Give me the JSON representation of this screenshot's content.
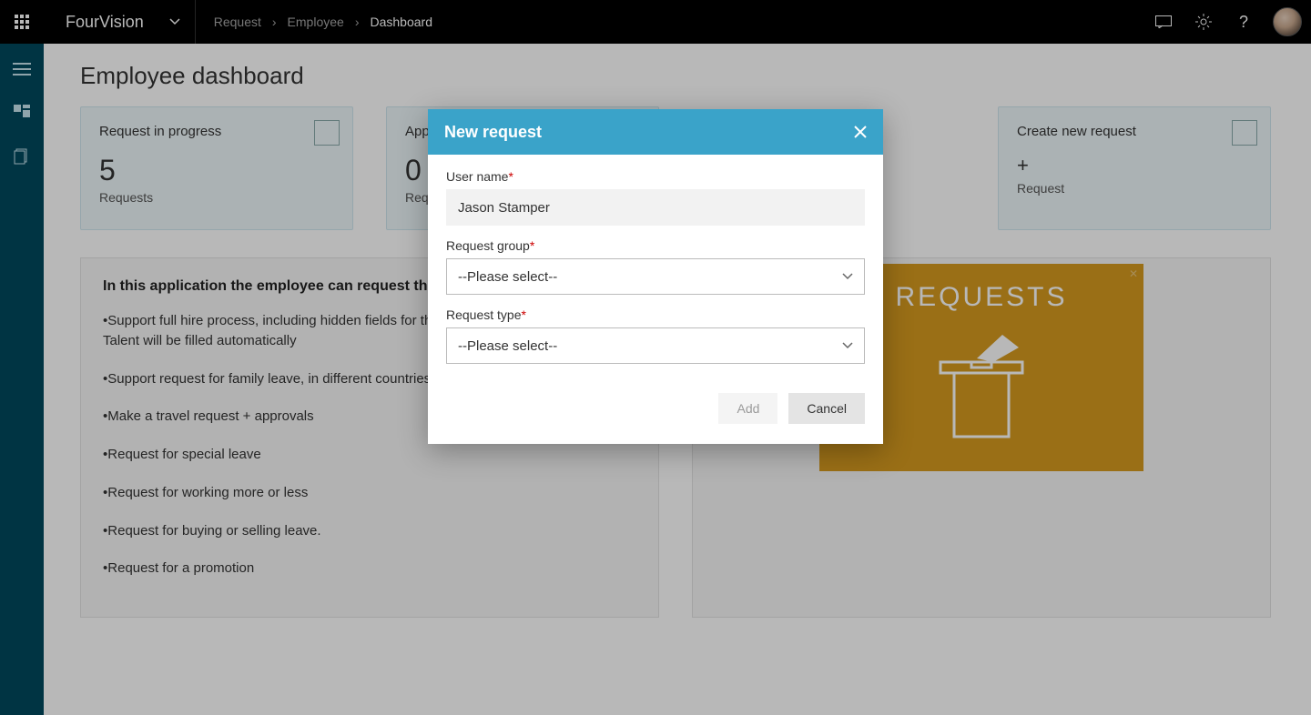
{
  "topbar": {
    "brand": "FourVision",
    "breadcrumb": [
      "Request",
      "Employee",
      "Dashboard"
    ]
  },
  "page": {
    "title": "Employee dashboard"
  },
  "tiles": [
    {
      "title": "Request in progress",
      "value": "5",
      "sub": "Requests"
    },
    {
      "title": "Approvals",
      "value": "0",
      "sub": "Requests"
    },
    {
      "title": "",
      "value": "",
      "sub": ""
    },
    {
      "title": "Create new request",
      "value": "+",
      "sub": "Request"
    }
  ],
  "info": {
    "heading": "In this application the employee can request things like:",
    "bullets": [
      "Support full hire process, including hidden fields for the approval process + all fields in Talent will be filled automatically",
      "Support request for family leave, in different countries",
      "Make a travel request + approvals",
      "Request for special leave",
      "Request for working more or less",
      "Request for buying or selling leave.",
      "Request for a promotion"
    ]
  },
  "banner": {
    "title": "REQUESTS"
  },
  "modal": {
    "title": "New request",
    "fields": {
      "username_label": "User name",
      "username_value": "Jason Stamper",
      "group_label": "Request group",
      "group_value": "--Please select--",
      "type_label": "Request type",
      "type_value": "--Please select--"
    },
    "buttons": {
      "add": "Add",
      "cancel": "Cancel"
    }
  }
}
